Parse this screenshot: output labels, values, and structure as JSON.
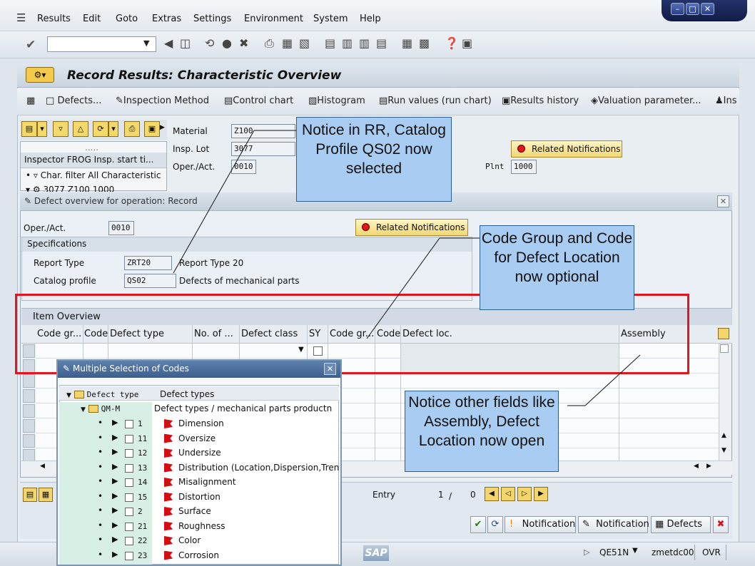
{
  "menu": {
    "items": [
      "Results",
      "Edit",
      "Goto",
      "Extras",
      "Settings",
      "Environment",
      "System",
      "Help"
    ]
  },
  "window_controls": [
    "minimize",
    "restore",
    "close"
  ],
  "title": "Record Results: Characteristic Overview",
  "app_toolbar": {
    "defects": "Defects...",
    "inspection_method": "Inspection Method",
    "control_chart": "Control chart",
    "histogram": "Histogram",
    "run_values": "Run values (run chart)",
    "results_history": "Results history",
    "valuation_parameter": "Valuation parameter...",
    "ins": "Ins"
  },
  "tree": {
    "dots": ".....",
    "header": "Inspector FROG Insp. start ti...",
    "row1": "Char. filter All Characteristic",
    "row2": "3077   Z100   1000"
  },
  "header": {
    "material_label": "Material",
    "material_value": "Z100",
    "insp_lot_label": "Insp. Lot",
    "insp_lot_value": "3077",
    "oper_label": "Oper./Act.",
    "oper_value": "0010",
    "plnt_label": "Plnt",
    "plnt_value": "1000",
    "related_notifications": "Related Notifications"
  },
  "callouts": {
    "rr": "Notice in RR, Catalog Profile QS02 now selected",
    "code_group": "Code Group and Code for Defect Location now optional",
    "other_fields": "Notice other fields like Assembly, Defect Location now open"
  },
  "dialog": {
    "title": "Defect overview for operation: Record",
    "oper_label": "Oper./Act.",
    "oper_value": "0010",
    "related_notifications": "Related Notifications",
    "specifications": "Specifications",
    "report_type_label": "Report Type",
    "report_type_value": "ZRT20",
    "report_type_text": "Report Type 20",
    "catalog_profile_label": "Catalog profile",
    "catalog_profile_value": "QS02",
    "catalog_profile_text": "Defects of mechanical parts",
    "item_overview": "Item Overview",
    "columns": [
      "Code gr...",
      "Code",
      "Defect type",
      "No. of ...",
      "Defect class",
      "SY",
      "Code gr...",
      "Code",
      "Defect loc.",
      "Assembly"
    ]
  },
  "bottom": {
    "entry_label": "Entry",
    "entry_current": "1",
    "entry_sep": "/",
    "entry_total": "0",
    "notification1": "Notification",
    "notification2": "Notification",
    "defects": "Defects"
  },
  "status": {
    "logo": "SAP",
    "transaction": "QE51N",
    "server": "zmetdc00",
    "mode": "OVR"
  },
  "popup": {
    "title": "Multiple Selection of Codes",
    "root_code": "Defect type",
    "root_text": "Defect types",
    "group_code": "QM-M",
    "group_text": "Defect types / mechanical parts productn",
    "codes": [
      {
        "code": "1",
        "text": "Dimension"
      },
      {
        "code": "11",
        "text": "Oversize"
      },
      {
        "code": "12",
        "text": "Undersize"
      },
      {
        "code": "13",
        "text": "Distribution (Location,Dispersion,Trenc"
      },
      {
        "code": "14",
        "text": "Misalignment"
      },
      {
        "code": "15",
        "text": "Distortion"
      },
      {
        "code": "2",
        "text": "Surface"
      },
      {
        "code": "21",
        "text": "Roughness"
      },
      {
        "code": "22",
        "text": "Color"
      },
      {
        "code": "23",
        "text": "Corrosion"
      }
    ]
  }
}
